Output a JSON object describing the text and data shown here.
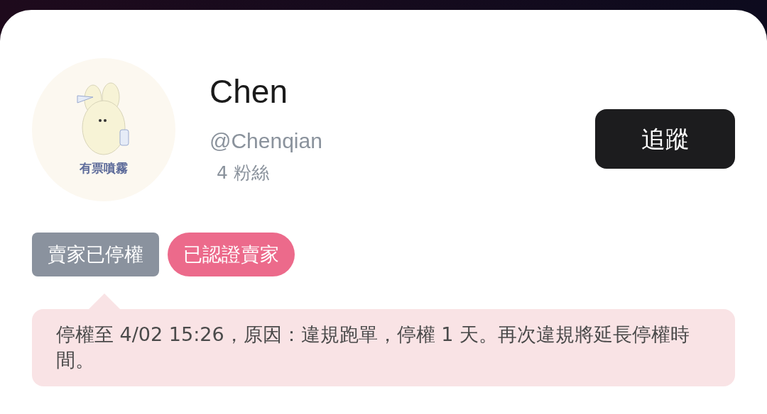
{
  "profile": {
    "avatar": {
      "caption": "有票噴霧"
    },
    "name": "Chen",
    "handle": "@Chenqian",
    "followers": "4 粉絲"
  },
  "follow_button": {
    "label": "追蹤"
  },
  "badges": [
    {
      "kind": "suspended",
      "label": "賣家已停權"
    },
    {
      "kind": "verified",
      "label": "已認證賣家"
    }
  ],
  "notice": {
    "text": "停權至 4/02 15:26，原因：違規跑單，停權 1 天。再次違規將延長停權時間。"
  }
}
